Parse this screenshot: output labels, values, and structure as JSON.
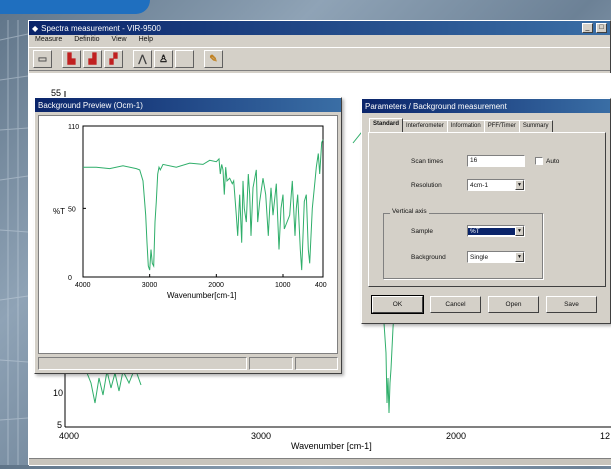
{
  "main_window": {
    "title": "Spectra measurement - VIR-9500",
    "menu": [
      "Measure",
      "Definitio",
      "View",
      "Help"
    ],
    "toolbar_icons": [
      "open-icon",
      "measure-sample-icon",
      "measure-background-icon",
      "measure-continuous-icon",
      "chart-icon",
      "peak-pick-icon",
      "blank-icon",
      "settings-icon"
    ],
    "plot": {
      "xlabel": "Wavenumber [cm-1]",
      "x_ticks": [
        "4000",
        "3000",
        "2000",
        "12"
      ],
      "y_ticks": [
        "55",
        "10",
        "5"
      ]
    }
  },
  "preview_window": {
    "title": "Background Preview (Ocm-1)"
  },
  "param_dialog": {
    "title": "Parameters / Background measurement",
    "tabs": [
      "Standard",
      "Interferometer",
      "Information",
      "PFF/Timer",
      "Summary"
    ],
    "active_tab": "Standard",
    "scan_times_label": "Scan times",
    "scan_times_value": "16",
    "auto_label": "Auto",
    "resolution_label": "Resolution",
    "resolution_value": "4cm-1",
    "vertical_axis_label": "Vertical axis",
    "sample_label": "Sample",
    "sample_value": "%T",
    "background_label": "Background",
    "background_value": "Single",
    "buttons": {
      "ok": "OK",
      "cancel": "Cancel",
      "open": "Open",
      "save": "Save"
    }
  },
  "colors": {
    "spectrum": "#2fae6a",
    "titlebar": "#0a246a",
    "selection": "#0a246a"
  },
  "chart_data": {
    "type": "line",
    "title": "",
    "xlabel": "Wavenumber[cm-1]",
    "ylabel": "%T",
    "xlim": [
      4000,
      400
    ],
    "ylim": [
      0,
      110
    ],
    "x_ticks": [
      4000,
      3000,
      2000,
      1000,
      400
    ],
    "y_ticks": [
      0,
      50,
      110
    ],
    "grid": false,
    "series": [
      {
        "x": [
          4000,
          3800,
          3600,
          3400,
          3200,
          3150,
          3100,
          3060,
          3040,
          3020,
          3000,
          2980,
          2960,
          2940,
          2920,
          2900,
          2880,
          2860,
          2840,
          2800,
          2600,
          2400,
          2200,
          2100,
          2000,
          1960,
          1940,
          1920,
          1900,
          1880,
          1860,
          1840,
          1800,
          1760,
          1740,
          1700,
          1680,
          1650,
          1620,
          1600,
          1580,
          1550,
          1520,
          1500,
          1480,
          1450,
          1400,
          1380,
          1350,
          1300,
          1260,
          1220,
          1200,
          1180,
          1150,
          1100,
          1060,
          1030,
          1000,
          980,
          940,
          900,
          860,
          820,
          800,
          780,
          760,
          740,
          720,
          700,
          680,
          650,
          620,
          600,
          560,
          520,
          500,
          470,
          450,
          420,
          400
        ],
        "y": [
          80,
          80,
          79,
          81,
          79,
          78,
          70,
          45,
          25,
          8,
          5,
          20,
          10,
          8,
          40,
          55,
          75,
          80,
          78,
          82,
          80,
          83,
          82,
          85,
          84,
          86,
          75,
          82,
          78,
          60,
          80,
          70,
          72,
          68,
          70,
          45,
          30,
          60,
          25,
          70,
          50,
          40,
          75,
          60,
          30,
          65,
          78,
          40,
          55,
          72,
          60,
          30,
          50,
          65,
          45,
          68,
          20,
          50,
          60,
          35,
          40,
          45,
          70,
          30,
          50,
          60,
          40,
          20,
          5,
          30,
          55,
          60,
          20,
          10,
          50,
          70,
          80,
          90,
          75,
          98,
          100
        ]
      }
    ]
  }
}
